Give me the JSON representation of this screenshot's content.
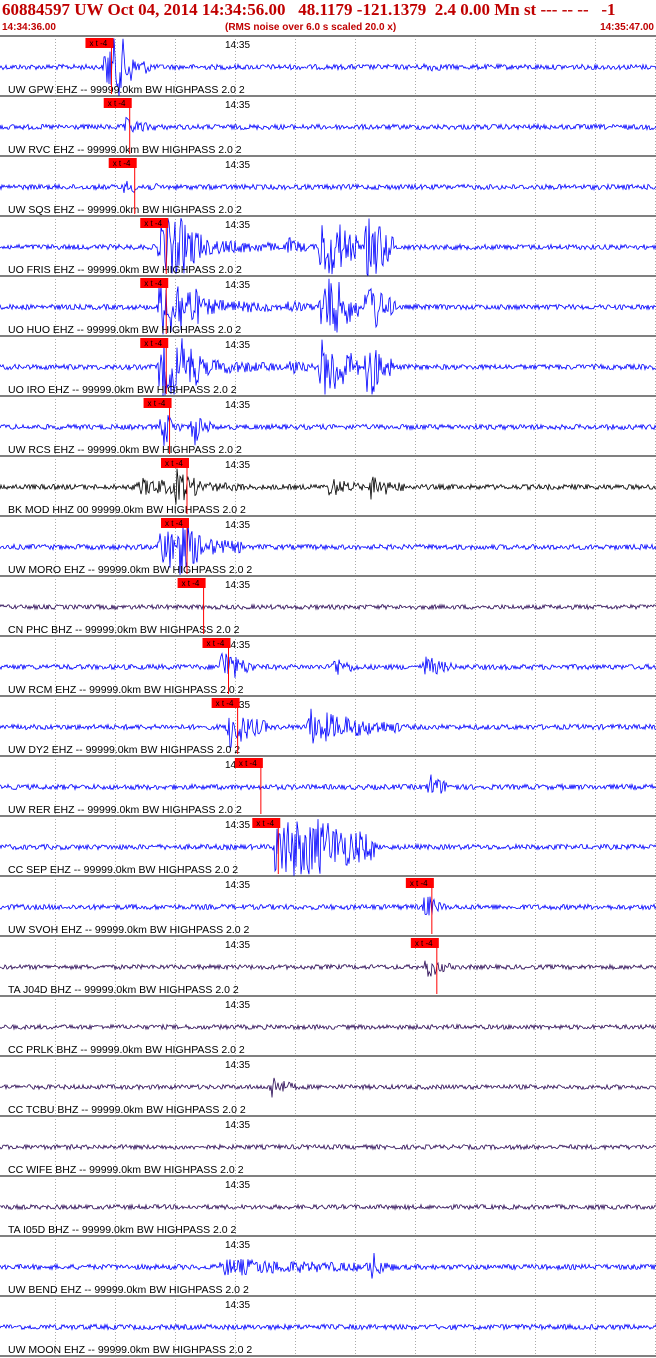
{
  "header": {
    "title": "60884597 UW Oct 04, 2014 14:34:56.00   48.1179 -121.1379  2.4 0.00 Mn st --- -- --   -1",
    "start_time": "14:34:36.00",
    "rms_note": "(RMS noise over 6.0 s scaled 20.0 x)",
    "end_time": "14:35:47.00"
  },
  "chart_data": {
    "type": "seismogram",
    "time_axis": {
      "start": "14:34:36.00",
      "end": "14:35:47.00",
      "minute_marker": "14:35"
    },
    "pick_label": "x t -4",
    "colors": {
      "blue": "#0000ff",
      "black": "#000000",
      "purple": "#2a0a55",
      "pick": "#ff0000",
      "text": "#000000",
      "header": "#c00000"
    },
    "traces": [
      {
        "label": "UW GPW EHZ -- 99999.0km BW  HIGHPASS  2.0  2",
        "color": "blue",
        "pick_time": 6.2,
        "bursts": [
          {
            "t": 6.0,
            "dur": 4.5,
            "amp": 1.2
          },
          {
            "t": 6.8,
            "dur": 1.5,
            "amp": 2.5
          },
          {
            "t": 44.5,
            "dur": 2.0,
            "amp": 0.15
          }
        ]
      },
      {
        "label": "UW RVC EHZ -- 99999.0km BW  HIGHPASS  2.0  2",
        "color": "blue",
        "pick_time": 8.4,
        "bursts": [
          {
            "t": 8.4,
            "dur": 3.0,
            "amp": 0.35
          }
        ]
      },
      {
        "label": "UW SQS EHZ -- 99999.0km BW  HIGHPASS  2.0  2",
        "color": "blue",
        "pick_time": 9.0,
        "bursts": [
          {
            "t": 8.3,
            "dur": 3.0,
            "amp": 0.25
          }
        ]
      },
      {
        "label": "UO FRIS EHZ -- 99999.0km BW  HIGHPASS  2.0  2",
        "color": "blue",
        "pick_time": 12.8,
        "bursts": [
          {
            "t": 12.6,
            "dur": 4.0,
            "amp": 2.5
          },
          {
            "t": 14.0,
            "dur": 12.0,
            "amp": 0.5
          },
          {
            "t": 28.0,
            "dur": 2.0,
            "amp": 0.4
          },
          {
            "t": 32.0,
            "dur": 3.5,
            "amp": 3.0
          },
          {
            "t": 37.5,
            "dur": 2.5,
            "amp": 3.0
          }
        ]
      },
      {
        "label": "UO HUO EHZ -- 99999.0km BW  HIGHPASS  2.0  2",
        "color": "blue",
        "pick_time": 12.8,
        "bursts": [
          {
            "t": 12.6,
            "dur": 4.0,
            "amp": 2.5
          },
          {
            "t": 14.0,
            "dur": 12.0,
            "amp": 0.5
          },
          {
            "t": 28.0,
            "dur": 2.0,
            "amp": 0.35
          },
          {
            "t": 32.0,
            "dur": 3.5,
            "amp": 3.0
          },
          {
            "t": 37.5,
            "dur": 2.5,
            "amp": 2.0
          }
        ]
      },
      {
        "label": "UO IRO EHZ -- 99999.0km BW  HIGHPASS  2.0  2",
        "color": "blue",
        "pick_time": 12.8,
        "bursts": [
          {
            "t": 12.6,
            "dur": 4.0,
            "amp": 2.5
          },
          {
            "t": 14.0,
            "dur": 12.0,
            "amp": 0.5
          },
          {
            "t": 28.0,
            "dur": 2.0,
            "amp": 0.4
          },
          {
            "t": 32.0,
            "dur": 3.5,
            "amp": 3.0
          },
          {
            "t": 37.5,
            "dur": 2.5,
            "amp": 2.0
          }
        ]
      },
      {
        "label": "UW RCS EHZ -- 99999.0km BW  HIGHPASS  2.0  2",
        "color": "blue",
        "pick_time": 13.2,
        "bursts": [
          {
            "t": 12.8,
            "dur": 1.5,
            "amp": 1.1
          },
          {
            "t": 16.5,
            "dur": 1.5,
            "amp": 1.0
          }
        ]
      },
      {
        "label": "BK MOD HHZ 00 99999.0km BW  HIGHPASS  2.0  2",
        "color": "black",
        "pick_time": 15.3,
        "bursts": [
          {
            "t": 10.0,
            "dur": 12.0,
            "amp": 0.35
          },
          {
            "t": 14.5,
            "dur": 2.5,
            "amp": 0.7
          },
          {
            "t": 33.0,
            "dur": 3.0,
            "amp": 0.45
          },
          {
            "t": 38.0,
            "dur": 3.0,
            "amp": 0.6
          }
        ]
      },
      {
        "label": "UW MORO EHZ -- 99999.0km BW  HIGHPASS  2.0  2",
        "color": "blue",
        "pick_time": 15.3,
        "bursts": [
          {
            "t": 12.5,
            "dur": 9.0,
            "amp": 0.9
          },
          {
            "t": 14.0,
            "dur": 3.0,
            "amp": 1.3
          }
        ]
      },
      {
        "label": "CN PHC BHZ -- 99999.0km BW  HIGHPASS  2.0  2",
        "color": "purple",
        "pick_time": 17.3,
        "bursts": []
      },
      {
        "label": "UW RCM EHZ -- 99999.0km BW  HIGHPASS  2.0  2",
        "color": "blue",
        "pick_time": 20.3,
        "bursts": [
          {
            "t": 20.0,
            "dur": 3.0,
            "amp": 1.0
          },
          {
            "t": 33.5,
            "dur": 2.0,
            "amp": 0.5
          },
          {
            "t": 44.5,
            "dur": 2.5,
            "amp": 0.55
          }
        ]
      },
      {
        "label": "UW DY2 EHZ -- 99999.0km BW  HIGHPASS  2.0  2",
        "color": "blue",
        "pick_time": 21.4,
        "bursts": [
          {
            "t": 20.8,
            "dur": 4.0,
            "amp": 1.1
          },
          {
            "t": 30.5,
            "dur": 10.0,
            "amp": 0.85
          }
        ]
      },
      {
        "label": "UW RER EHZ -- 99999.0km BW  HIGHPASS  2.0  2",
        "color": "blue",
        "pick_time": 24.2,
        "bursts": [
          {
            "t": 45.0,
            "dur": 2.5,
            "amp": 0.6
          }
        ]
      },
      {
        "label": "CC SEP EHZ -- 99999.0km BW  HIGHPASS  2.0  2",
        "color": "blue",
        "pick_time": 26.3,
        "bursts": [
          {
            "t": 26.5,
            "dur": 11.0,
            "amp": 3.0
          }
        ]
      },
      {
        "label": "UW SVOH EHZ -- 99999.0km BW  HIGHPASS  2.0  2",
        "color": "blue",
        "pick_time": 44.8,
        "bursts": [
          {
            "t": 44.5,
            "dur": 1.5,
            "amp": 0.7
          }
        ]
      },
      {
        "label": "TA J04D BHZ -- 99999.0km BW  HIGHPASS  2.0  2",
        "color": "purple",
        "pick_time": 45.4,
        "bursts": [
          {
            "t": 44.7,
            "dur": 2.0,
            "amp": 0.6
          }
        ]
      },
      {
        "label": "CC PRLK BHZ -- 99999.0km BW  HIGHPASS  2.0  2",
        "color": "purple",
        "pick_time": null,
        "bursts": []
      },
      {
        "label": "CC TCBU BHZ -- 99999.0km BW  HIGHPASS  2.0  2",
        "color": "purple",
        "pick_time": null,
        "bursts": [
          {
            "t": 26.0,
            "dur": 2.0,
            "amp": 0.6
          }
        ]
      },
      {
        "label": "CC WIFE BHZ -- 99999.0km BW  HIGHPASS  2.0  2",
        "color": "purple",
        "pick_time": null,
        "bursts": []
      },
      {
        "label": "TA I05D BHZ -- 99999.0km BW  HIGHPASS  2.0  2",
        "color": "purple",
        "pick_time": null,
        "bursts": []
      },
      {
        "label": "UW BEND EHZ -- 99999.0km BW  HIGHPASS  2.0  2",
        "color": "blue",
        "pick_time": null,
        "bursts": [
          {
            "t": 20.0,
            "dur": 20.0,
            "amp": 0.35
          },
          {
            "t": 38.0,
            "dur": 1.0,
            "amp": 0.8
          }
        ]
      },
      {
        "label": "UW MOON EHZ -- 99999.0km BW  HIGHPASS  2.0  2",
        "color": "blue",
        "pick_time": null,
        "bursts": []
      }
    ]
  }
}
